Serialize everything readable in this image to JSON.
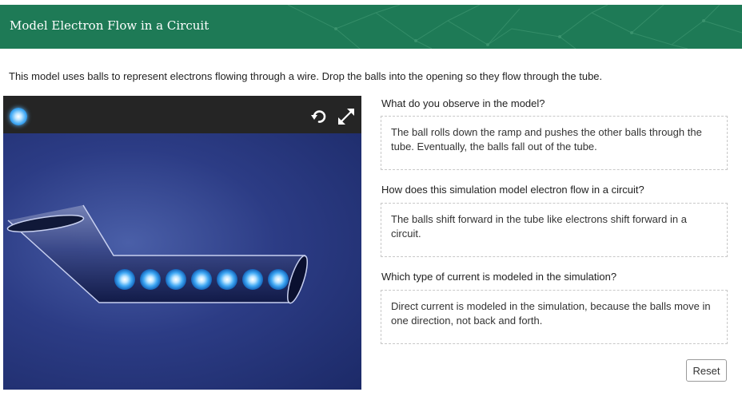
{
  "header": {
    "title": "Model Electron Flow in a Circuit",
    "color": "#1e7a56"
  },
  "intro": "This model uses balls to represent electrons flowing through a wire. Drop the balls into the opening  so they flow through the tube.",
  "simulation": {
    "icons": {
      "ball": "ball-source-icon",
      "reset": "reset-icon",
      "expand": "expand-icon"
    },
    "balls_in_tube": 7
  },
  "questions": [
    {
      "prompt": "What do you observe in the model?",
      "answer": "The ball rolls down the ramp and pushes the other balls through the tube. Eventually, the balls fall out of the tube."
    },
    {
      "prompt": "How does this simulation model electron flow in a circuit?",
      "answer": "The balls shift forward in the tube like electrons shift forward in a circuit."
    },
    {
      "prompt": "Which type of current is modeled in the simulation?",
      "answer": "Direct current is modeled in the simulation, because the balls move in one direction, not back and forth."
    }
  ],
  "reset_label": "Reset"
}
